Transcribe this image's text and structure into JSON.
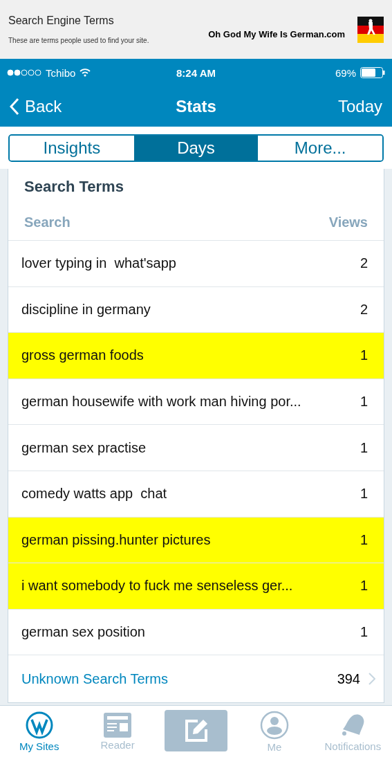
{
  "header": {
    "title": "Search Engine Terms",
    "subtitle": "These are terms people used to find your site.",
    "site": "Oh God My Wife Is German.com"
  },
  "status_bar": {
    "carrier": "Tchibo",
    "time": "8:24 AM",
    "battery": "69%"
  },
  "nav": {
    "back": "Back",
    "title": "Stats",
    "action": "Today"
  },
  "tabs": [
    {
      "label": "Insights",
      "selected": false
    },
    {
      "label": "Days",
      "selected": true
    },
    {
      "label": "More...",
      "selected": false
    }
  ],
  "card": {
    "title": "Search Terms",
    "columns": [
      "Search",
      "Views"
    ],
    "rows": [
      {
        "term": "lover typing in  what'sapp",
        "views": "2",
        "highlighted": false
      },
      {
        "term": "discipline in germany",
        "views": "2",
        "highlighted": false
      },
      {
        "term": "gross german foods",
        "views": "1",
        "highlighted": true
      },
      {
        "term": "german housewife with work man hiving por...",
        "views": "1",
        "highlighted": false
      },
      {
        "term": "german sex practise",
        "views": "1",
        "highlighted": false
      },
      {
        "term": "comedy watts app  chat",
        "views": "1",
        "highlighted": false
      },
      {
        "term": "german pissing.hunter pictures",
        "views": "1",
        "highlighted": true
      },
      {
        "term": "i want somebody to fuck me senseless ger...",
        "views": "1",
        "highlighted": true
      },
      {
        "term": "german sex position",
        "views": "1",
        "highlighted": false
      }
    ],
    "footer": {
      "label": "Unknown Search Terms",
      "count": "394"
    }
  },
  "tab_bar": [
    {
      "kind": "sites",
      "label": "My Sites",
      "selected": true
    },
    {
      "kind": "reader",
      "label": "Reader",
      "selected": false
    },
    {
      "kind": "write"
    },
    {
      "kind": "me",
      "label": "Me",
      "selected": false
    },
    {
      "kind": "notifications",
      "label": "Notifications",
      "selected": false
    }
  ]
}
